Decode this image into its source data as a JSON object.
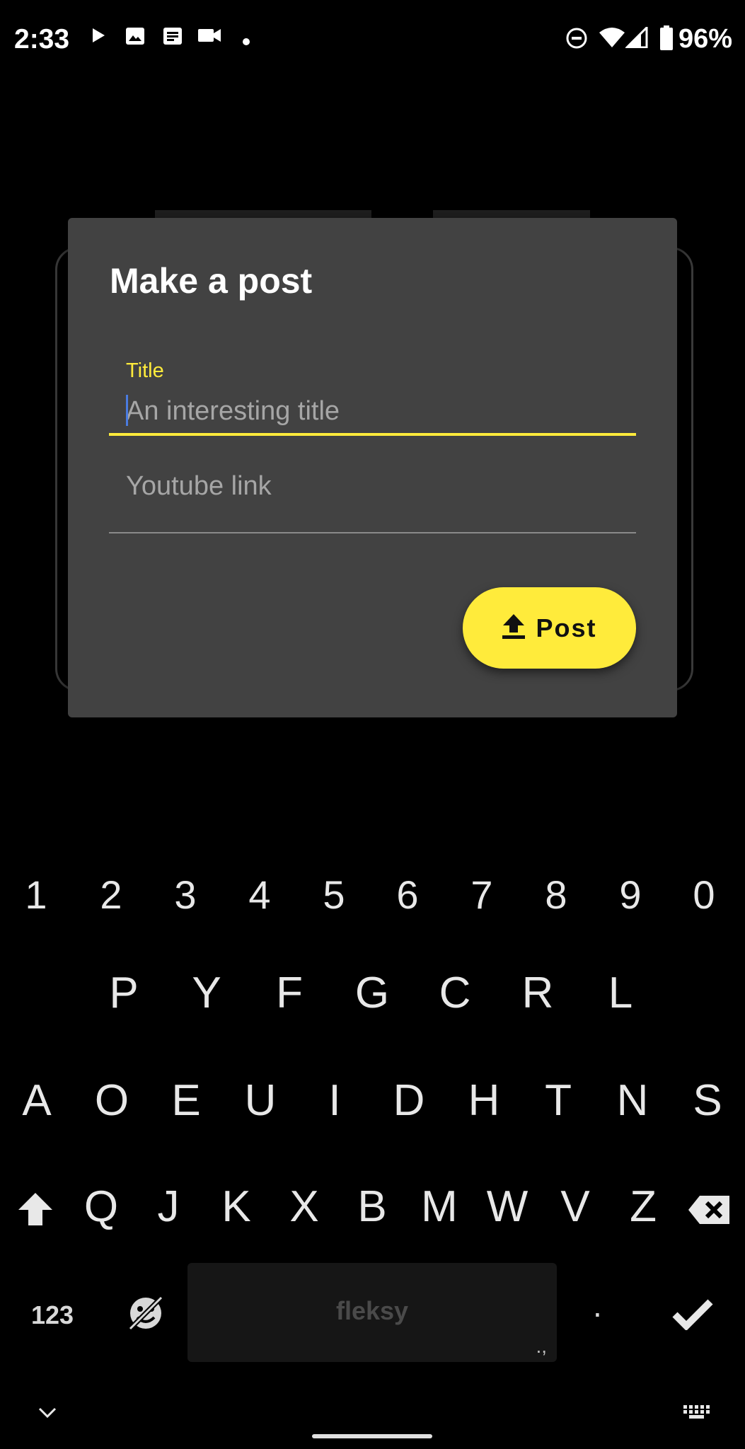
{
  "status_bar": {
    "time": "2:33",
    "battery": "96%",
    "icons": [
      "play-icon",
      "image-icon",
      "news-icon",
      "video-camera-icon",
      "dot-icon",
      "do-not-disturb-icon",
      "wifi-icon",
      "signal-icon",
      "battery-icon"
    ]
  },
  "dialog": {
    "title": "Make a post",
    "title_field": {
      "label": "Title",
      "placeholder": "An interesting title"
    },
    "link_field": {
      "placeholder": "Youtube link"
    },
    "post_button": {
      "label": "Post",
      "icon": "upload-icon"
    }
  },
  "keyboard": {
    "number_row": [
      "1",
      "2",
      "3",
      "4",
      "5",
      "6",
      "7",
      "8",
      "9",
      "0"
    ],
    "row1": [
      "P",
      "Y",
      "F",
      "G",
      "C",
      "R",
      "L"
    ],
    "row2": [
      "A",
      "O",
      "E",
      "U",
      "I",
      "D",
      "H",
      "T",
      "N",
      "S"
    ],
    "row3": [
      "Q",
      "J",
      "K",
      "X",
      "B",
      "M",
      "W",
      "V",
      "Z"
    ],
    "numbers_key": "123",
    "spacebar_label": "fleksy",
    "spacebar_punct": ".,",
    "period_key": ".",
    "colors": {
      "accent": "#ffeb3b",
      "dialog": "#424242"
    }
  }
}
